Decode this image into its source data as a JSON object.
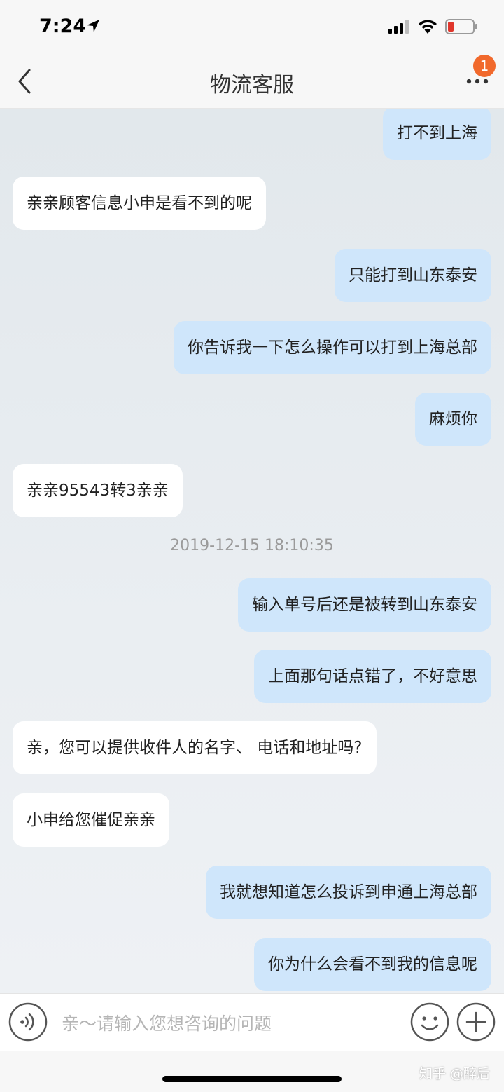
{
  "status": {
    "time": "7:24"
  },
  "nav": {
    "title": "物流客服",
    "badge": "1"
  },
  "chat": {
    "timestamp": "2019-12-15 18:10:35",
    "messages": [
      {
        "side": "right",
        "text": "打不到上海"
      },
      {
        "side": "left",
        "text": "亲亲顾客信息小申是看不到的呢"
      },
      {
        "side": "right",
        "text": "只能打到山东泰安"
      },
      {
        "side": "right",
        "text": "你告诉我一下怎么操作可以打到上海总部"
      },
      {
        "side": "right",
        "text": "麻烦你"
      },
      {
        "side": "left",
        "text": "亲亲95543转3亲亲"
      },
      {
        "side": "right",
        "text": "输入单号后还是被转到山东泰安"
      },
      {
        "side": "right",
        "text": "上面那句话点错了，不好意思"
      },
      {
        "side": "left",
        "text": "亲，您可以提供收件人的名字、 电话和地址吗?"
      },
      {
        "side": "left",
        "text": "小申给您催促亲亲"
      },
      {
        "side": "right",
        "text": "我就想知道怎么投诉到申通上海总部"
      },
      {
        "side": "right",
        "text": "你为什么会看不到我的信息呢"
      }
    ]
  },
  "input": {
    "placeholder": "亲～请输入您想咨询的问题",
    "value": ""
  },
  "watermark": "知乎 @醉后",
  "icons": {
    "back": "chevron-left-icon",
    "more": "more-dots-icon",
    "voice": "voice-icon",
    "emoji": "emoji-icon",
    "plus": "plus-icon"
  },
  "colors": {
    "user_bubble": "#cfe6fb",
    "agent_bubble": "#ffffff",
    "badge": "#f1692c",
    "battery_low": "#e0362c"
  }
}
